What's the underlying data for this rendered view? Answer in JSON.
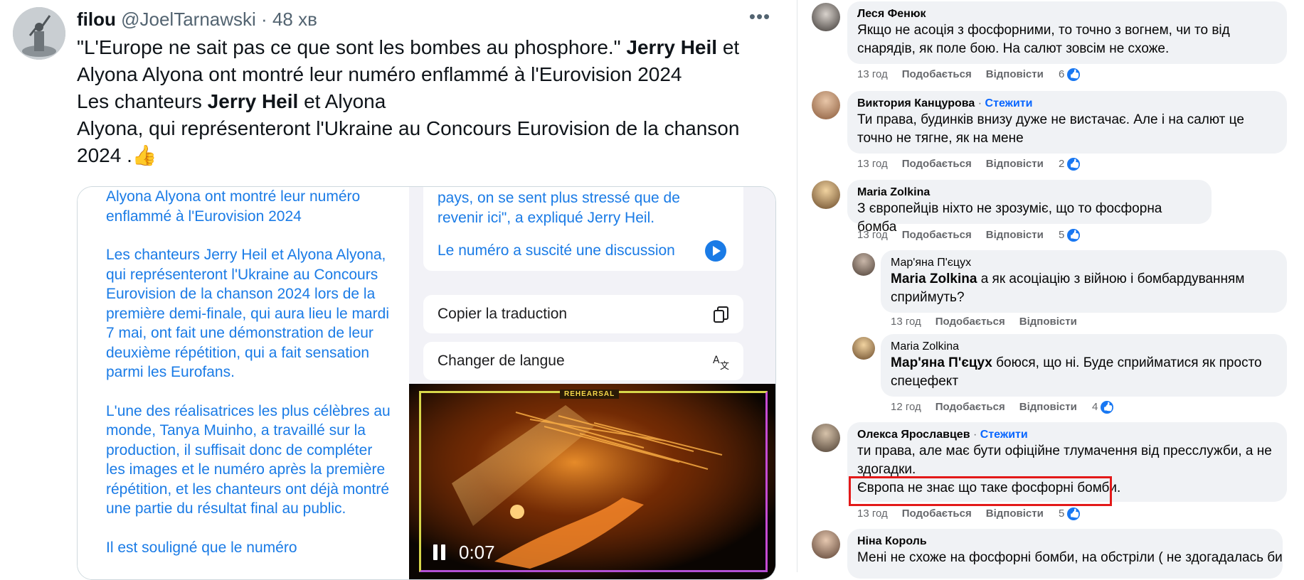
{
  "tweet": {
    "display_name": "filou",
    "handle": "@JoelTarnawski",
    "separator": "·",
    "time": "48 хв",
    "more": "•••",
    "line1_pre": "\"L'Europe ne sait pas ce que sont les bombes au phosphore.\" ",
    "line1_bold": "Jerry Heil",
    "line1_post": " et",
    "line2": "Alyona Alyona ont montré leur numéro enflammé à l'Eurovision 2024",
    "line3_pre": "Les chanteurs ",
    "line3_bold": "Jerry Heil",
    "line3_post": " et Alyona",
    "line4": "Alyona, qui représenteront l'Ukraine au Concours Eurovision de la chanson",
    "line5": "2024 .👍"
  },
  "media": {
    "left_p1": "Alyona Alyona ont montré leur numéro enflammé à l'Eurovision 2024",
    "left_p2": "Les chanteurs Jerry Heil et Alyona Alyona, qui représenteront l'Ukraine au Concours Eurovision de la chanson 2024 lors de la première demi-finale, qui aura lieu le mardi 7 mai, ont fait une démonstration de leur deuxième répétition, qui a fait sensation parmi les Eurofans.",
    "left_p3": "L'une des réalisatrices les plus célèbres au monde, Tanya Muinho, a travaillé sur la production, il suffisait donc de compléter les images et le numéro après la première répétition, et les chanteurs ont déjà montré une partie du résultat final au public.",
    "left_p4": "Il est souligné que le numéro",
    "card_text": "pays, on se sent plus stressé que de revenir ici\", a expliqué Jerry Heil.",
    "card_link": "Le numéro a suscité une discussion",
    "copy_label": "Copier la traduction",
    "lang_label": "Changer de langue",
    "video_badge": "REHEARSAL",
    "video_time": "0:07"
  },
  "comments": [
    {
      "name": "Леся Фенюк",
      "text": "Якщо не асоція з фосфорними, то точно з вогнем, чи то від снарядів, як поле бою. На салют зовсім не схоже.",
      "time": "13 год",
      "like": "Подобається",
      "reply": "Відповісти",
      "count": "6"
    },
    {
      "name": "Виктория Канцурова",
      "follow": "Стежити",
      "text": "Ти права, будинків внизу дуже не вистачає. Але і на салют це точно не тягне, як на мене",
      "time": "13 год",
      "like": "Подобається",
      "reply": "Відповісти",
      "count": "2"
    },
    {
      "name": "Maria Zolkina",
      "text": "З європейців ніхто не зрозуміє, що то фосфорна бомба",
      "time": "13 год",
      "like": "Подобається",
      "reply": "Відповісти",
      "count": "5"
    },
    {
      "name": "Мар'яна П'єцух",
      "mention": "Maria Zolkina",
      "text": " а як асоціацію з війною і бомбардуванням сприймуть?",
      "time": "13 год",
      "like": "Подобається",
      "reply": "Відповісти"
    },
    {
      "name": "Maria Zolkina",
      "mention": "Мар'яна П'єцух",
      "text": " боюся, що ні. Буде сприйматися як просто спецефект",
      "time": "12 год",
      "like": "Подобається",
      "reply": "Відповісти",
      "count": "4"
    },
    {
      "name": "Олекса Ярославцев",
      "follow": "Стежити",
      "text": "ти права, але має бути офіційне тлумачення від пресслужби, а не здогадки.",
      "text2": "Європа не знає що таке фосфорні бомби.",
      "time": "13 год",
      "like": "Подобається",
      "reply": "Відповісти",
      "count": "5"
    },
    {
      "name": "Ніна Король",
      "text": "Мені не схоже на фосфорні бомби, на обстріли ( не здогадалась би"
    }
  ],
  "colors": {
    "link_blue": "#1a7be6",
    "fb_blue": "#0866ff",
    "highlight_red": "#e31919",
    "bubble": "#f0f2f5"
  }
}
